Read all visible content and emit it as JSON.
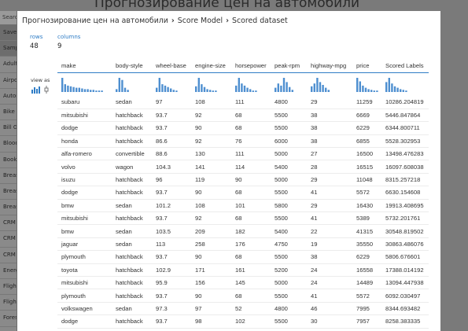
{
  "background": {
    "title": "Прогнозирование цен на автомобили",
    "search_placeholder": "Search experiment items",
    "sidebar_items": [
      "Saved",
      "Sample",
      "Adult",
      "Airport",
      "Automobile",
      "Bike R",
      "Bill Ga",
      "Blood",
      "Book",
      "Breast",
      "Breast",
      "Breast",
      "CRM",
      "CRM",
      "CRM",
      "Energy",
      "Flight",
      "Flight",
      "Forest"
    ]
  },
  "breadcrumb": {
    "experiment": "Прогнозирование цен на автомобили",
    "module": "Score Model",
    "output": "Scored dataset"
  },
  "stats": {
    "rows_label": "rows",
    "rows_value": "48",
    "columns_label": "columns",
    "columns_value": "9"
  },
  "view_as_label": "view as",
  "table": {
    "columns": [
      "make",
      "body-style",
      "wheel-base",
      "engine-size",
      "horsepower",
      "peak-rpm",
      "highway-mpg",
      "price",
      "Scored Labels"
    ],
    "histograms": [
      [
        1.0,
        0.55,
        0.45,
        0.4,
        0.35,
        0.3,
        0.3,
        0.25,
        0.2,
        0.2,
        0.15,
        0.15,
        0.1,
        0.1,
        0.1
      ],
      [
        0.2,
        1.0,
        0.85,
        0.3,
        0.15
      ],
      [
        0.3,
        1.0,
        0.55,
        0.45,
        0.35,
        0.25,
        0.15,
        0.1
      ],
      [
        0.4,
        1.0,
        0.55,
        0.35,
        0.2,
        0.15,
        0.1,
        0.1
      ],
      [
        0.45,
        1.0,
        0.6,
        0.45,
        0.3,
        0.2,
        0.1,
        0.1
      ],
      [
        0.3,
        0.6,
        0.45,
        1.0,
        0.7,
        0.35,
        0.15
      ],
      [
        0.4,
        0.6,
        1.0,
        0.7,
        0.5,
        0.3,
        0.15
      ],
      [
        1.0,
        0.75,
        0.45,
        0.3,
        0.2,
        0.15,
        0.1,
        0.1
      ],
      [
        0.7,
        1.0,
        0.6,
        0.4,
        0.3,
        0.2,
        0.15,
        0.1
      ]
    ],
    "rows": [
      [
        "subaru",
        "sedan",
        "97",
        "108",
        "111",
        "4800",
        "29",
        "11259",
        "10286.204819"
      ],
      [
        "mitsubishi",
        "hatchback",
        "93.7",
        "92",
        "68",
        "5500",
        "38",
        "6669",
        "5446.847864"
      ],
      [
        "dodge",
        "hatchback",
        "93.7",
        "90",
        "68",
        "5500",
        "38",
        "6229",
        "6344.800711"
      ],
      [
        "honda",
        "hatchback",
        "86.6",
        "92",
        "76",
        "6000",
        "38",
        "6855",
        "5528.302953"
      ],
      [
        "alfa-romero",
        "convertible",
        "88.6",
        "130",
        "111",
        "5000",
        "27",
        "16500",
        "13498.476283"
      ],
      [
        "volvo",
        "wagon",
        "104.3",
        "141",
        "114",
        "5400",
        "28",
        "16515",
        "16097.608038"
      ],
      [
        "isuzu",
        "hatchback",
        "96",
        "119",
        "90",
        "5000",
        "29",
        "11048",
        "8315.257218"
      ],
      [
        "dodge",
        "hatchback",
        "93.7",
        "90",
        "68",
        "5500",
        "41",
        "5572",
        "6630.154608"
      ],
      [
        "bmw",
        "sedan",
        "101.2",
        "108",
        "101",
        "5800",
        "29",
        "16430",
        "19913.408695"
      ],
      [
        "mitsubishi",
        "hatchback",
        "93.7",
        "92",
        "68",
        "5500",
        "41",
        "5389",
        "5732.201761"
      ],
      [
        "bmw",
        "sedan",
        "103.5",
        "209",
        "182",
        "5400",
        "22",
        "41315",
        "30548.819502"
      ],
      [
        "jaguar",
        "sedan",
        "113",
        "258",
        "176",
        "4750",
        "19",
        "35550",
        "30863.486076"
      ],
      [
        "plymouth",
        "hatchback",
        "93.7",
        "90",
        "68",
        "5500",
        "38",
        "6229",
        "5806.676601"
      ],
      [
        "toyota",
        "hatchback",
        "102.9",
        "171",
        "161",
        "5200",
        "24",
        "16558",
        "17388.014192"
      ],
      [
        "mitsubishi",
        "hatchback",
        "95.9",
        "156",
        "145",
        "5000",
        "24",
        "14489",
        "13094.447938"
      ],
      [
        "plymouth",
        "hatchback",
        "93.7",
        "90",
        "68",
        "5500",
        "41",
        "5572",
        "6092.030497"
      ],
      [
        "volkswagen",
        "sedan",
        "97.3",
        "97",
        "52",
        "4800",
        "46",
        "7995",
        "8344.693482"
      ],
      [
        "dodge",
        "hatchback",
        "93.7",
        "98",
        "102",
        "5500",
        "30",
        "7957",
        "8258.383335"
      ]
    ]
  },
  "colors": {
    "accent": "#2f7dc6",
    "bar": "#4e8fd0"
  }
}
